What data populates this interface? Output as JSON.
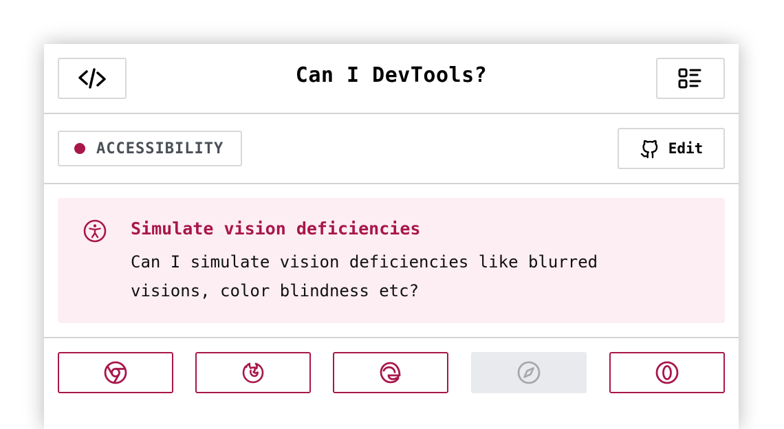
{
  "header": {
    "title": "Can I DevTools?",
    "left_icon": "code-icon",
    "right_icon": "list-icon"
  },
  "meta": {
    "category": "ACCESSIBILITY",
    "category_color": "#a8164a",
    "edit_label": "Edit",
    "edit_icon": "github-icon"
  },
  "feature": {
    "icon": "accessibility-icon",
    "title": "Simulate vision deficiencies",
    "description": "Can I simulate vision deficiencies like blurred visions, color blindness etc?",
    "background": "#fdeef3",
    "accent": "#a8164a"
  },
  "browsers": [
    {
      "name": "chrome",
      "icon": "chrome-icon",
      "supported": true
    },
    {
      "name": "firefox",
      "icon": "firefox-icon",
      "supported": true
    },
    {
      "name": "edge",
      "icon": "edge-icon",
      "supported": true
    },
    {
      "name": "safari",
      "icon": "safari-icon",
      "supported": false
    },
    {
      "name": "opera",
      "icon": "opera-icon",
      "supported": true
    }
  ]
}
